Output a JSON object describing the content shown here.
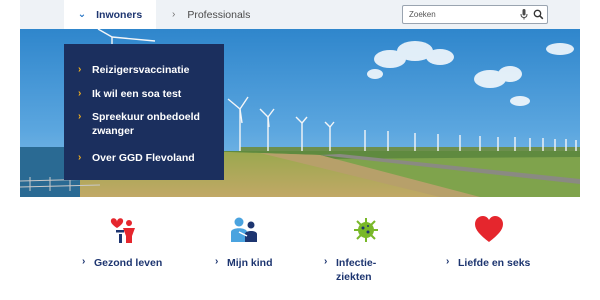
{
  "topnav": {
    "tabs": [
      {
        "label": "Inwoners",
        "icon": "chevron-down-icon",
        "active": true
      },
      {
        "label": "Professionals",
        "icon": "chevron-right-icon",
        "active": false
      }
    ],
    "search": {
      "placeholder": "Zoeken",
      "value": "",
      "icons": [
        "microphone-icon",
        "search-icon"
      ]
    }
  },
  "dropdown": {
    "items": [
      {
        "label": "Reizigersvaccinatie"
      },
      {
        "label": "Ik wil een soa test"
      },
      {
        "label": "Spreekuur onbedoeld zwanger"
      },
      {
        "label": "Over GGD Flevoland"
      }
    ],
    "chevron": "chevron-right-icon"
  },
  "categories": [
    {
      "label": "Gezond leven",
      "icon": "heart-person-icon"
    },
    {
      "label": "Mijn kind",
      "icon": "parent-child-icon"
    },
    {
      "label": "Infectie-ziekten",
      "icon": "virus-icon"
    },
    {
      "label": "Liefde en seks",
      "icon": "heart-icon"
    }
  ],
  "colors": {
    "primary": "#1d3570",
    "accent": "#f2b01e",
    "dropdown_bg": "#1b2f5e",
    "heart": "#e5262d",
    "virus": "#79b829",
    "child_icon": "#4aa3df"
  }
}
